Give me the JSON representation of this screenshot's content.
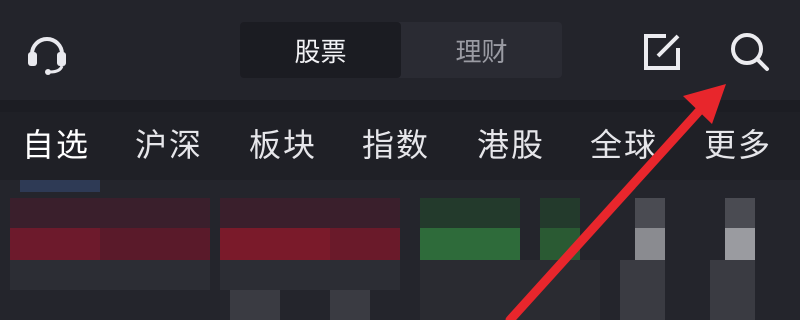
{
  "topbar": {
    "tabs": [
      {
        "label": "股票",
        "active": true
      },
      {
        "label": "理财",
        "active": false
      }
    ],
    "icons": [
      "headset-icon",
      "edit-icon",
      "search-icon"
    ]
  },
  "nav": {
    "items": [
      {
        "label": "自选",
        "active": true
      },
      {
        "label": "沪深",
        "active": false
      },
      {
        "label": "板块",
        "active": false
      },
      {
        "label": "指数",
        "active": false
      },
      {
        "label": "港股",
        "active": false
      },
      {
        "label": "全球",
        "active": false
      },
      {
        "label": "更多",
        "active": false
      }
    ]
  },
  "colors": {
    "background": "#1c1d23",
    "up_red": "#7a1a2a",
    "down_green": "#2e6b3a",
    "annotation_arrow": "#e8262c"
  }
}
